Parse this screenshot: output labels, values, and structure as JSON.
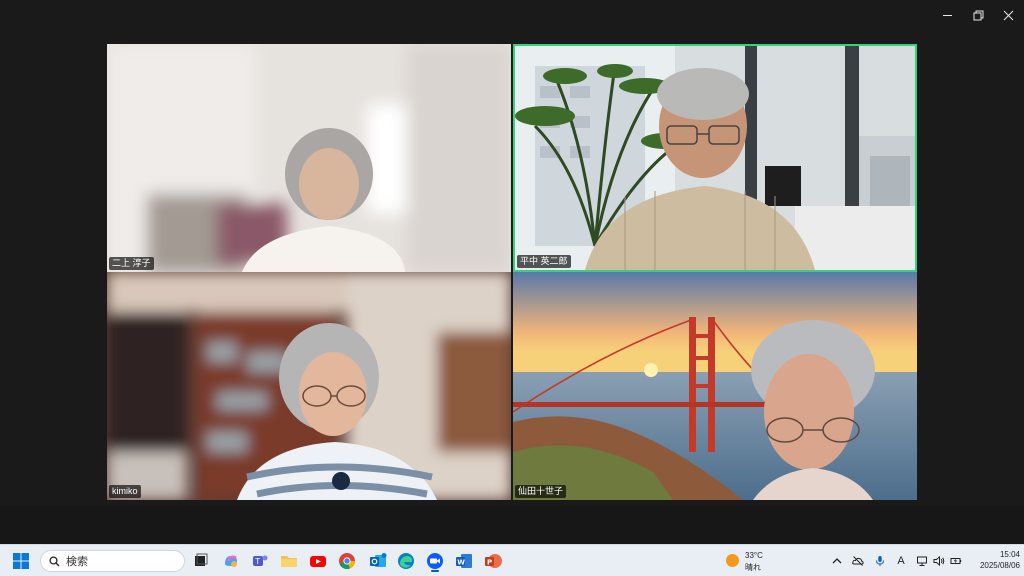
{
  "window": {
    "controls": {
      "minimize": "minimize",
      "maximize": "maximize",
      "close": "close"
    }
  },
  "participants": [
    {
      "name": "二上 淳子",
      "speaking": false
    },
    {
      "name": "平中 英二郎",
      "speaking": true
    },
    {
      "name": "kimiko",
      "speaking": false
    },
    {
      "name": "仙田十世子",
      "speaking": false
    }
  ],
  "taskbar": {
    "search_placeholder": "検索",
    "weather": {
      "temp": "33°C",
      "condition": "晴れ"
    },
    "clock": {
      "time": "15:04",
      "date": "2025/08/06"
    },
    "tray_text_icon": "A"
  },
  "colors": {
    "active_speaker_border": "#2fd47b",
    "taskbar_bg": "#e9eef5"
  }
}
